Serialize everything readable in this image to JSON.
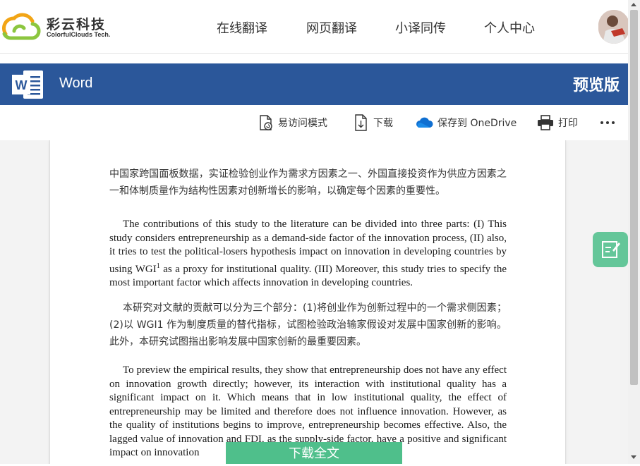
{
  "header": {
    "logo_cn": "彩云科技",
    "logo_en": "ColorfulClouds Tech.",
    "nav": [
      "在线翻译",
      "网页翻译",
      "小译同传",
      "个人中心"
    ]
  },
  "wordbar": {
    "app_name": "Word",
    "badge": "预览版"
  },
  "toolbar": {
    "accessible": "易访问模式",
    "download": "下载",
    "save_onedrive": "保存到 OneDrive",
    "print": "打印"
  },
  "document": {
    "para1_cn": "中国家跨国面板数据，实证检验创业作为需求方因素之一、外国直接投资作为供应方因素之一和体制质量作为结构性因素对创新增长的影响，以确定每个因素的重要性。",
    "para2_en_a": "The contributions of this study to the literature can be divided into three parts: (I) This study considers entrepreneurship as a demand-side factor of the innovation process, (II) also, it tries to test the political-losers hypothesis impact on innovation in developing countries by using WGI",
    "para2_en_sup": "1",
    "para2_en_b": " as a proxy for institutional quality. (III) Moreover, this study tries to specify the most important factor which affects innovation in developing countries.",
    "para3_cn": "本研究对文献的贡献可以分为三个部分：(1)将创业作为创新过程中的一个需求侧因素；(2)以 WGI1 作为制度质量的替代指标，试图检验政治输家假设对发展中国家创新的影响。此外，本研究试图指出影响发展中国家创新的最重要因素。",
    "para4_en": "To preview the empirical results, they show that entrepreneurship does not have any effect on innovation growth directly; however, its interaction with institutional quality has a significant impact on it. Which means that in low institutional quality, the effect of entrepreneurship may be limited and therefore does not influence innovation. However, as the quality of institutions begins to improve, entrepreneurship becomes effective. Also, the lagged value of innovation and FDI, as the supply-side factor, have a positive and significant impact on innovation"
  },
  "download_all": "下载全文",
  "colors": {
    "word_blue": "#2b579a",
    "accent_green": "#4fbf8b"
  }
}
